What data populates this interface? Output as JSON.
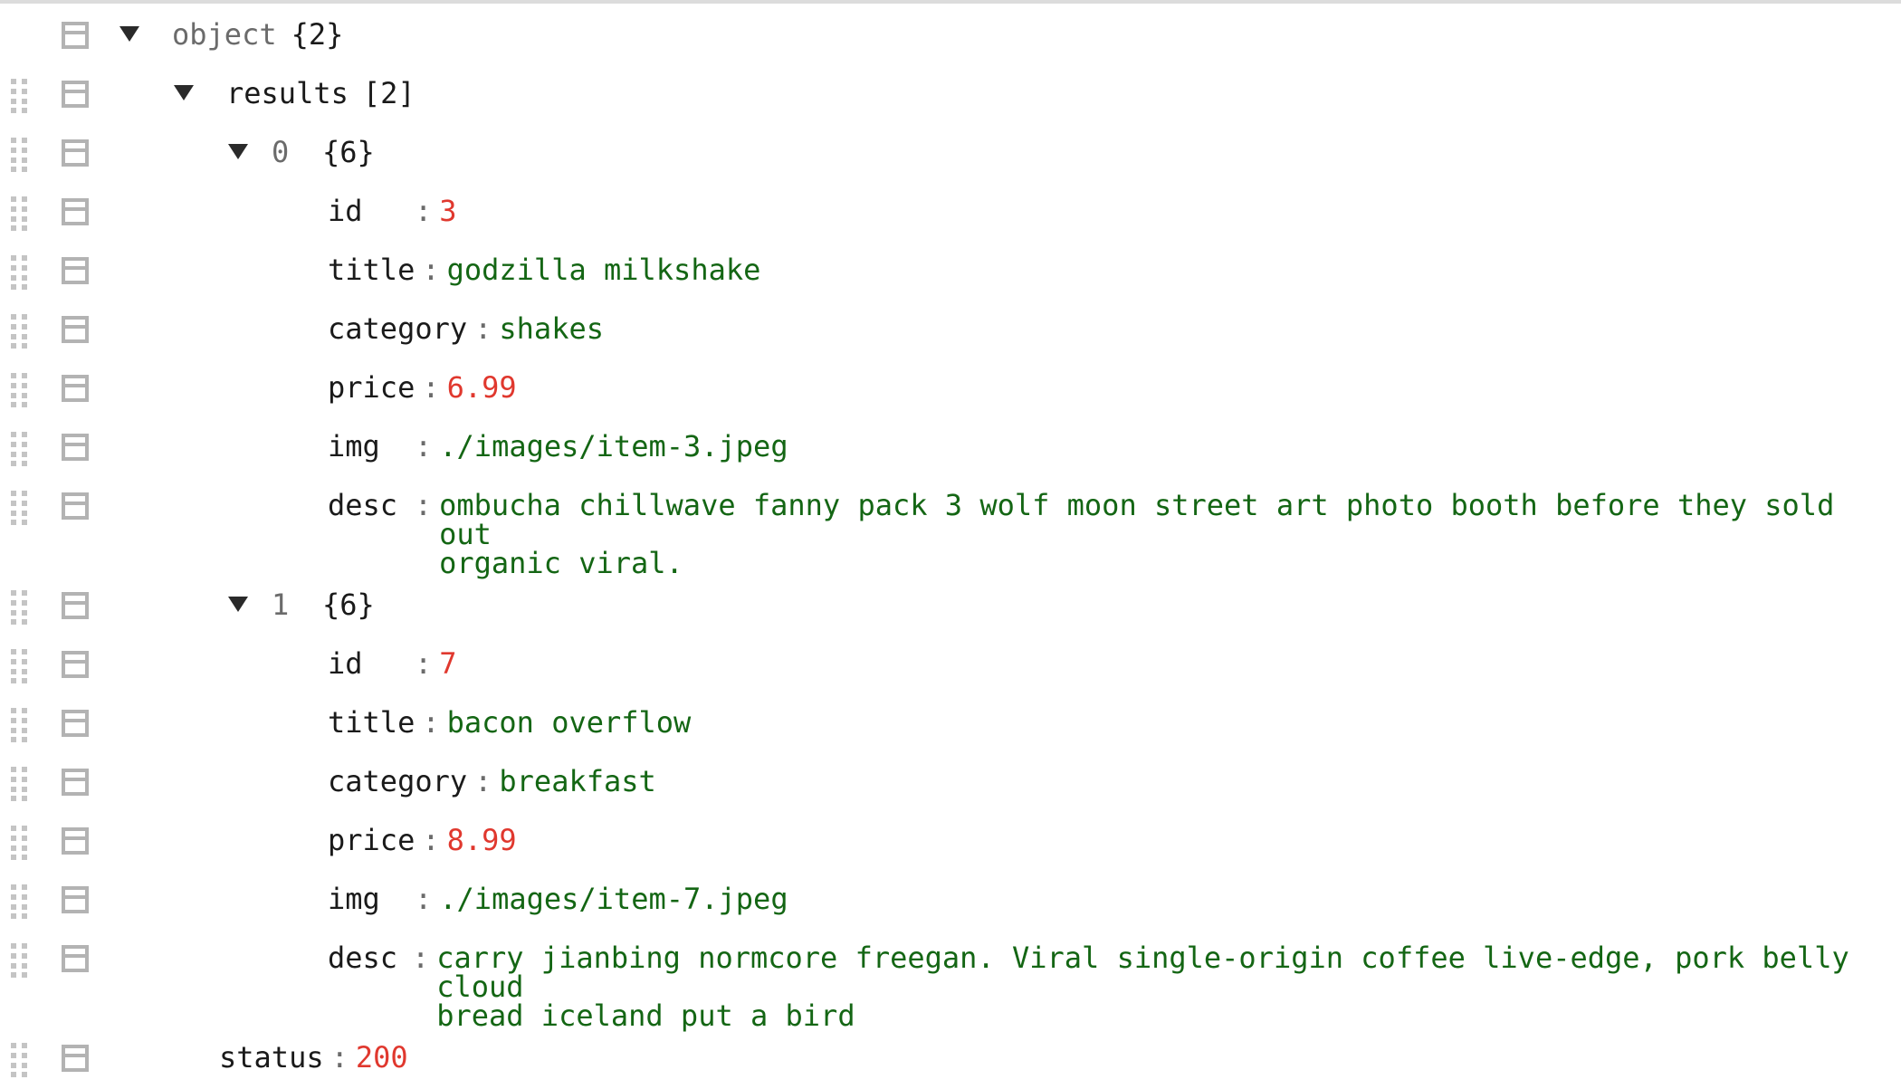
{
  "root": {
    "type_label": "object",
    "count": "{2}"
  },
  "results": {
    "key": "results",
    "count": "[2]",
    "items": [
      {
        "index": "0",
        "count": "{6}",
        "fields": [
          {
            "key": "id",
            "sep": ":",
            "value": "3",
            "kind": "number"
          },
          {
            "key": "title",
            "sep": ":",
            "value": "godzilla milkshake",
            "kind": "string"
          },
          {
            "key": "category",
            "sep": ":",
            "value": "shakes",
            "kind": "string"
          },
          {
            "key": "price",
            "sep": ":",
            "value": "6.99",
            "kind": "number"
          },
          {
            "key": "img",
            "sep": ":",
            "value": "./images/item-3.jpeg",
            "kind": "string"
          },
          {
            "key": "desc",
            "sep": ":",
            "value": "ombucha chillwave fanny pack 3 wolf moon street art photo booth before they sold out\norganic viral.",
            "kind": "string"
          }
        ]
      },
      {
        "index": "1",
        "count": "{6}",
        "fields": [
          {
            "key": "id",
            "sep": ":",
            "value": "7",
            "kind": "number"
          },
          {
            "key": "title",
            "sep": ":",
            "value": "bacon overflow",
            "kind": "string"
          },
          {
            "key": "category",
            "sep": ":",
            "value": "breakfast",
            "kind": "string"
          },
          {
            "key": "price",
            "sep": ":",
            "value": "8.99",
            "kind": "number"
          },
          {
            "key": "img",
            "sep": ":",
            "value": "./images/item-7.jpeg",
            "kind": "string"
          },
          {
            "key": "desc",
            "sep": ":",
            "value": "carry jianbing normcore freegan. Viral single-origin coffee live-edge, pork belly cloud\nbread iceland put a bird",
            "kind": "string"
          }
        ]
      }
    ]
  },
  "status": {
    "key": "status",
    "sep": ":",
    "value": "200"
  },
  "icons": {
    "expand": "triangle-down-icon",
    "drag": "drag-handle-icon",
    "menu": "context-menu-icon"
  },
  "colors": {
    "number": "#e0382e",
    "string": "#146614",
    "muted": "#6b6b6b",
    "icon": "#b3b3b3"
  }
}
